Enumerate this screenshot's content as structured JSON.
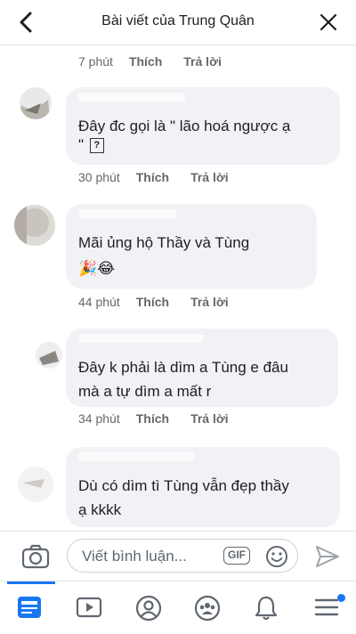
{
  "header": {
    "title": "Bài viết của Trung Quân"
  },
  "comments": [
    {
      "text_lines": [],
      "time": "7 phút",
      "like": "Thích",
      "reply": "Trả lời"
    },
    {
      "text_lines": [
        "Đây đc gọi là \" lão hoá ngược ạ",
        "\""
      ],
      "trailing_glyph": "?",
      "time": "30 phút",
      "like": "Thích",
      "reply": "Trả lời"
    },
    {
      "text_lines": [
        "Mãi ủng hộ Thầy và Tùng"
      ],
      "emoji": "🎉😂",
      "time": "44 phút",
      "like": "Thích",
      "reply": "Trả lời"
    },
    {
      "text_lines": [
        "Đây k phải là dìm a Tùng e đâu",
        "mà a tự dìm a mất r"
      ],
      "time": "34 phút",
      "like": "Thích",
      "reply": "Trả lời"
    },
    {
      "text_lines": [
        "Dù có dìm tì Tùng vẫn đẹp thầy",
        "ạ kkkk"
      ],
      "time": "",
      "like": "",
      "reply": ""
    }
  ],
  "composer": {
    "placeholder": "Viết bình luận...",
    "gif_label": "GIF"
  },
  "nav": {
    "items": [
      "news-feed",
      "watch",
      "profile",
      "groups",
      "notifications",
      "menu"
    ],
    "active": "news-feed",
    "accent": "#1877f2"
  }
}
